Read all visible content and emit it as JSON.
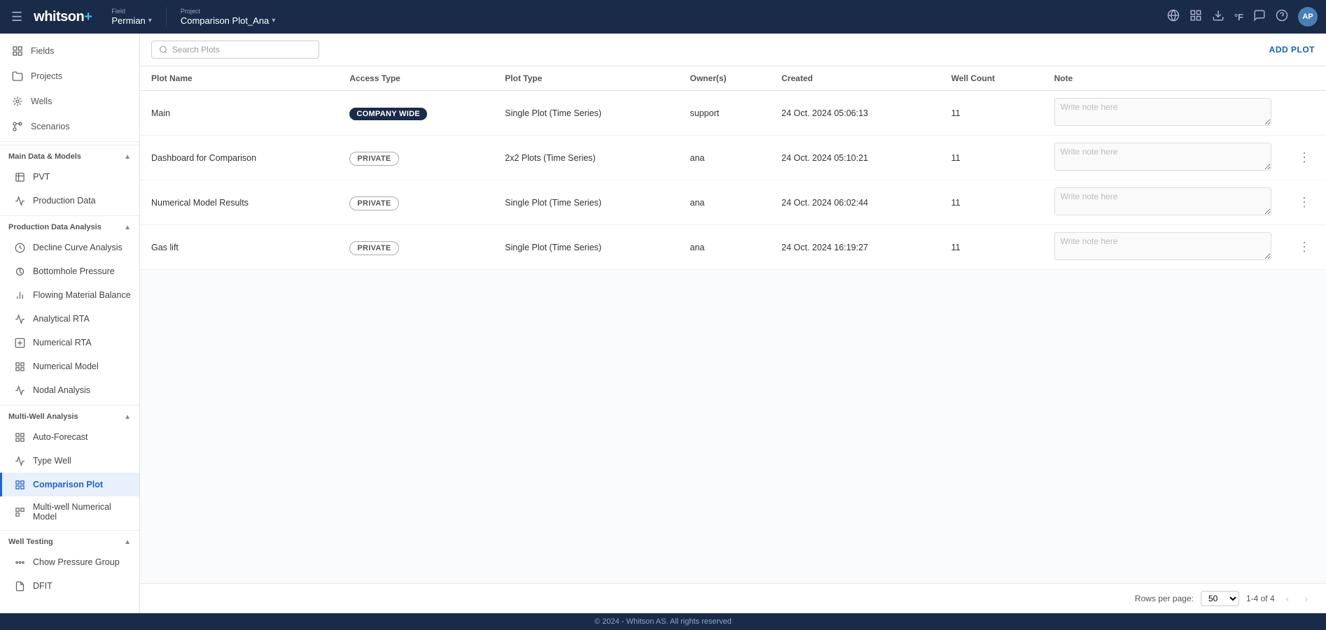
{
  "header": {
    "menu_icon": "☰",
    "logo_text": "whitson",
    "logo_plus": "+",
    "field_label": "Field",
    "field_value": "Permian",
    "project_label": "Project",
    "project_value": "Comparison Plot_Ana",
    "icons": {
      "globe": "🌐",
      "grid": "⊞",
      "download": "⬇",
      "temp": "°F",
      "chat": "💬",
      "help": "?",
      "avatar": "AP"
    }
  },
  "sidebar": {
    "top_items": [
      {
        "label": "Fields",
        "icon": "grid"
      },
      {
        "label": "Projects",
        "icon": "folder"
      },
      {
        "label": "Wells",
        "icon": "circle-dot"
      },
      {
        "label": "Scenarios",
        "icon": "branch"
      }
    ],
    "sections": [
      {
        "title": "Main Data & Models",
        "items": [
          {
            "label": "PVT",
            "icon": "flask"
          },
          {
            "label": "Production Data",
            "icon": "line-chart"
          }
        ]
      },
      {
        "title": "Production Data Analysis",
        "items": [
          {
            "label": "Decline Curve Analysis",
            "icon": "decline"
          },
          {
            "label": "Bottomhole Pressure",
            "icon": "gauge"
          },
          {
            "label": "Flowing Material Balance",
            "icon": "balance"
          },
          {
            "label": "Analytical RTA",
            "icon": "rta"
          },
          {
            "label": "Numerical RTA",
            "icon": "num-rta"
          },
          {
            "label": "Numerical Model",
            "icon": "num-model"
          },
          {
            "label": "Nodal Analysis",
            "icon": "nodal"
          }
        ]
      },
      {
        "title": "Multi-Well Analysis",
        "items": [
          {
            "label": "Auto-Forecast",
            "icon": "auto-forecast"
          },
          {
            "label": "Type Well",
            "icon": "type-well"
          },
          {
            "label": "Comparison Plot",
            "icon": "comparison",
            "active": true
          },
          {
            "label": "Multi-well Numerical Model",
            "icon": "multi-num"
          }
        ]
      },
      {
        "title": "Well Testing",
        "items": [
          {
            "label": "Chow Pressure Group",
            "icon": "chow"
          },
          {
            "label": "DFIT",
            "icon": "dfit"
          }
        ]
      }
    ]
  },
  "content": {
    "search_placeholder": "Search Plots",
    "add_plot_label": "ADD PLOT",
    "table": {
      "columns": [
        "Plot Name",
        "Access Type",
        "Plot Type",
        "Owner(s)",
        "Created",
        "Well Count",
        "Note"
      ],
      "rows": [
        {
          "name": "Main",
          "access_type": "COMPANY WIDE",
          "access_class": "company",
          "plot_type": "Single Plot (Time Series)",
          "owner": "support",
          "created": "24 Oct. 2024 05:06:13",
          "well_count": "11",
          "note_placeholder": "Write note here"
        },
        {
          "name": "Dashboard for Comparison",
          "access_type": "PRIVATE",
          "access_class": "private",
          "plot_type": "2x2 Plots (Time Series)",
          "owner": "ana",
          "created": "24 Oct. 2024 05:10:21",
          "well_count": "11",
          "note_placeholder": "Write note here"
        },
        {
          "name": "Numerical Model Results",
          "access_type": "PRIVATE",
          "access_class": "private",
          "plot_type": "Single Plot (Time Series)",
          "owner": "ana",
          "created": "24 Oct. 2024 06:02:44",
          "well_count": "11",
          "note_placeholder": "Write note here"
        },
        {
          "name": "Gas lift",
          "access_type": "PRIVATE",
          "access_class": "private",
          "plot_type": "Single Plot (Time Series)",
          "owner": "ana",
          "created": "24 Oct. 2024 16:19:27",
          "well_count": "11",
          "note_placeholder": "Write note here"
        }
      ]
    },
    "pagination": {
      "rows_per_page_label": "Rows per page:",
      "rows_per_page_value": "50",
      "range": "1-4 of 4"
    }
  },
  "footer": {
    "text": "© 2024 - Whitson AS. All rights reserved"
  }
}
